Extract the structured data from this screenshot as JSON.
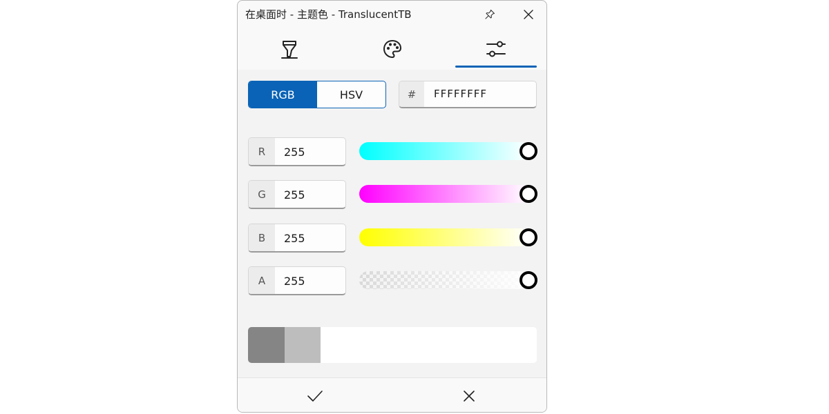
{
  "window": {
    "title": "在桌面时 - 主题色 - TranslucentTB",
    "titlebar_icons": [
      "pin-icon",
      "close-icon"
    ]
  },
  "tabs": [
    {
      "icon": "marker-icon",
      "selected": false
    },
    {
      "icon": "palette-icon",
      "selected": false
    },
    {
      "icon": "sliders-icon",
      "selected": true
    }
  ],
  "mode": {
    "options": [
      "RGB",
      "HSV"
    ],
    "selected": "RGB"
  },
  "hex": {
    "prefix": "#",
    "value": "FFFFFFFF"
  },
  "channels": [
    {
      "label": "R",
      "value": "255",
      "level": 1.0
    },
    {
      "label": "G",
      "value": "255",
      "level": 1.0
    },
    {
      "label": "B",
      "value": "255",
      "level": 1.0
    },
    {
      "label": "A",
      "value": "255",
      "level": 1.0
    }
  ],
  "preview": {
    "previous_colors": [
      "#858585",
      "#bdbdbd"
    ],
    "current_color": "#ffffff"
  },
  "footer": {
    "buttons": [
      "check-icon",
      "close-icon"
    ]
  },
  "colors": {
    "accent": "#0a63b6"
  }
}
